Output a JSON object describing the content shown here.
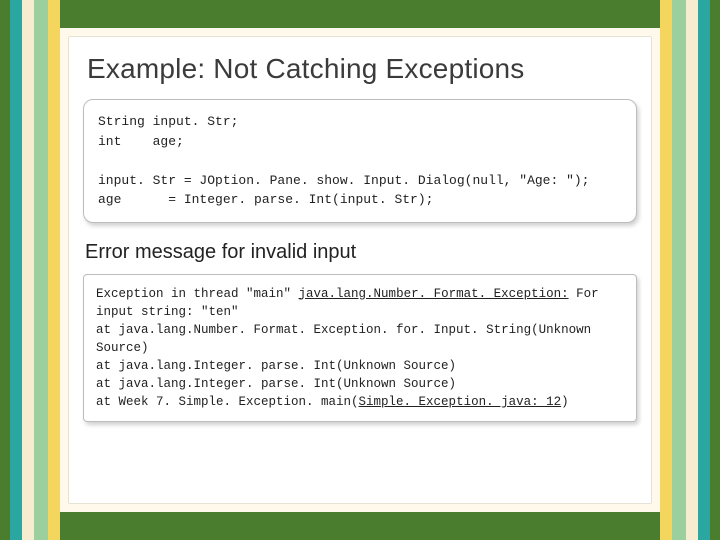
{
  "title": "Example: Not Catching Exceptions",
  "code": {
    "l1": "String input. Str;",
    "l2": "int    age;",
    "l3": "",
    "l4": "input. Str = JOption. Pane. show. Input. Dialog(null, \"Age: \");",
    "l5": "age      = Integer. parse. Int(input. Str);"
  },
  "subhead": "Error message for invalid input",
  "error": {
    "l1a": "Exception in thread \"main\" ",
    "l1b": "java.lang.Number. Format. Exception:",
    "l1c": " For",
    "l2": "input string: \"ten\"",
    "l3": "at java.lang.Number. Format. Exception. for. Input. String(Unknown Source)",
    "l4": "at java.lang.Integer. parse. Int(Unknown Source)",
    "l5": "at java.lang.Integer. parse. Int(Unknown Source)",
    "l6a": "at Week 7. Simple. Exception. main(",
    "l6b": "Simple. Exception. java: 12",
    "l6c": ")"
  }
}
